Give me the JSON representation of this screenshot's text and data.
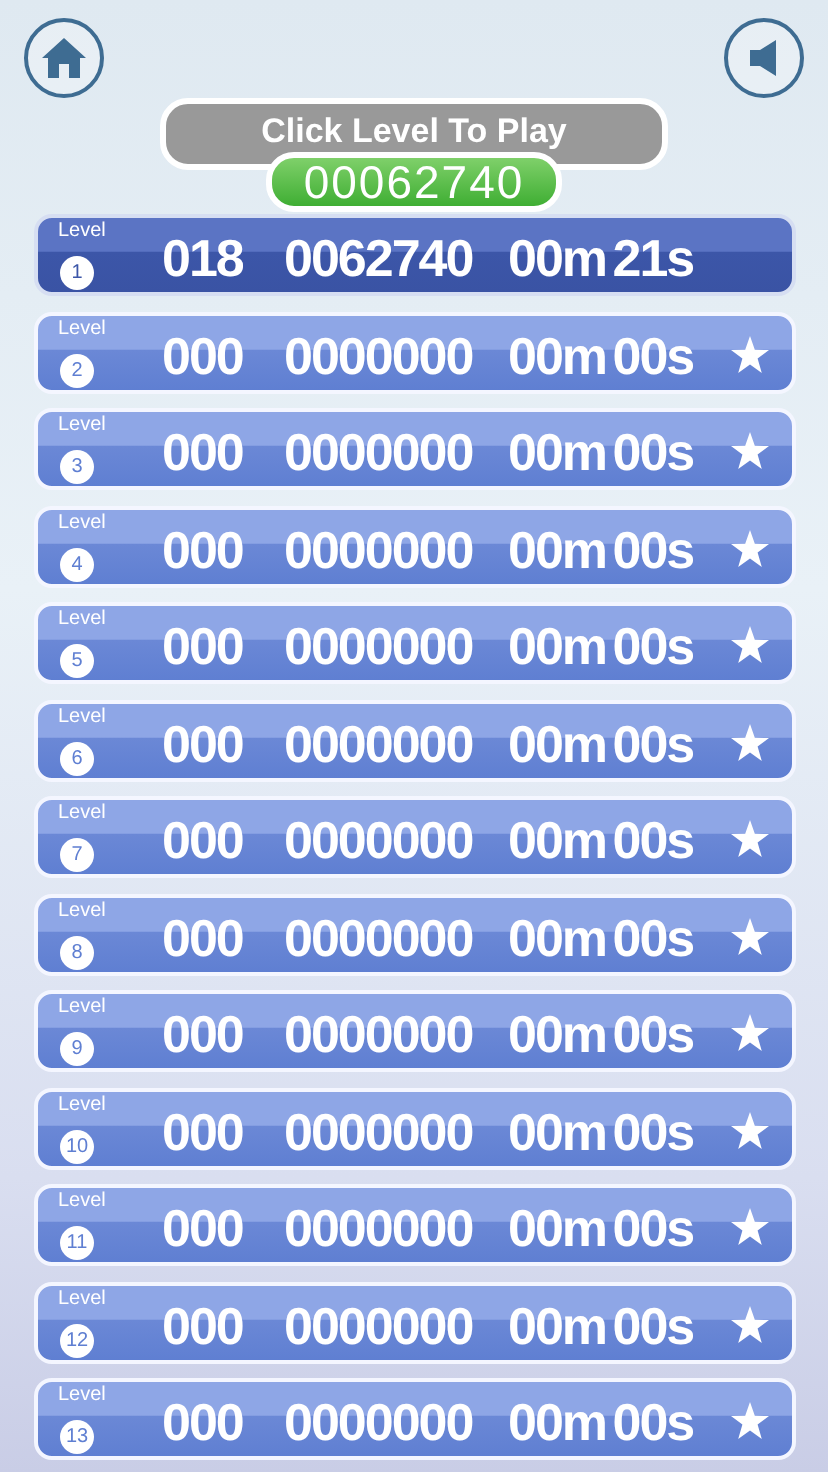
{
  "header": {
    "title": "Click Level To Play",
    "total_score": "00062740"
  },
  "levels": [
    {
      "label": "Level",
      "number": "1",
      "moves": "018",
      "score": "0062740",
      "time": "00m 21s",
      "selected": true,
      "star": false
    },
    {
      "label": "Level",
      "number": "2",
      "moves": "000",
      "score": "0000000",
      "time": "00m 00s",
      "selected": false,
      "star": true
    },
    {
      "label": "Level",
      "number": "3",
      "moves": "000",
      "score": "0000000",
      "time": "00m 00s",
      "selected": false,
      "star": true
    },
    {
      "label": "Level",
      "number": "4",
      "moves": "000",
      "score": "0000000",
      "time": "00m 00s",
      "selected": false,
      "star": true
    },
    {
      "label": "Level",
      "number": "5",
      "moves": "000",
      "score": "0000000",
      "time": "00m 00s",
      "selected": false,
      "star": true
    },
    {
      "label": "Level",
      "number": "6",
      "moves": "000",
      "score": "0000000",
      "time": "00m 00s",
      "selected": false,
      "star": true
    },
    {
      "label": "Level",
      "number": "7",
      "moves": "000",
      "score": "0000000",
      "time": "00m 00s",
      "selected": false,
      "star": true
    },
    {
      "label": "Level",
      "number": "8",
      "moves": "000",
      "score": "0000000",
      "time": "00m 00s",
      "selected": false,
      "star": true
    },
    {
      "label": "Level",
      "number": "9",
      "moves": "000",
      "score": "0000000",
      "time": "00m 00s",
      "selected": false,
      "star": true
    },
    {
      "label": "Level",
      "number": "10",
      "moves": "000",
      "score": "0000000",
      "time": "00m 00s",
      "selected": false,
      "star": true
    },
    {
      "label": "Level",
      "number": "11",
      "moves": "000",
      "score": "0000000",
      "time": "00m 00s",
      "selected": false,
      "star": true
    },
    {
      "label": "Level",
      "number": "12",
      "moves": "000",
      "score": "0000000",
      "time": "00m 00s",
      "selected": false,
      "star": true
    },
    {
      "label": "Level",
      "number": "13",
      "moves": "000",
      "score": "0000000",
      "time": "00m 00s",
      "selected": false,
      "star": true
    }
  ]
}
